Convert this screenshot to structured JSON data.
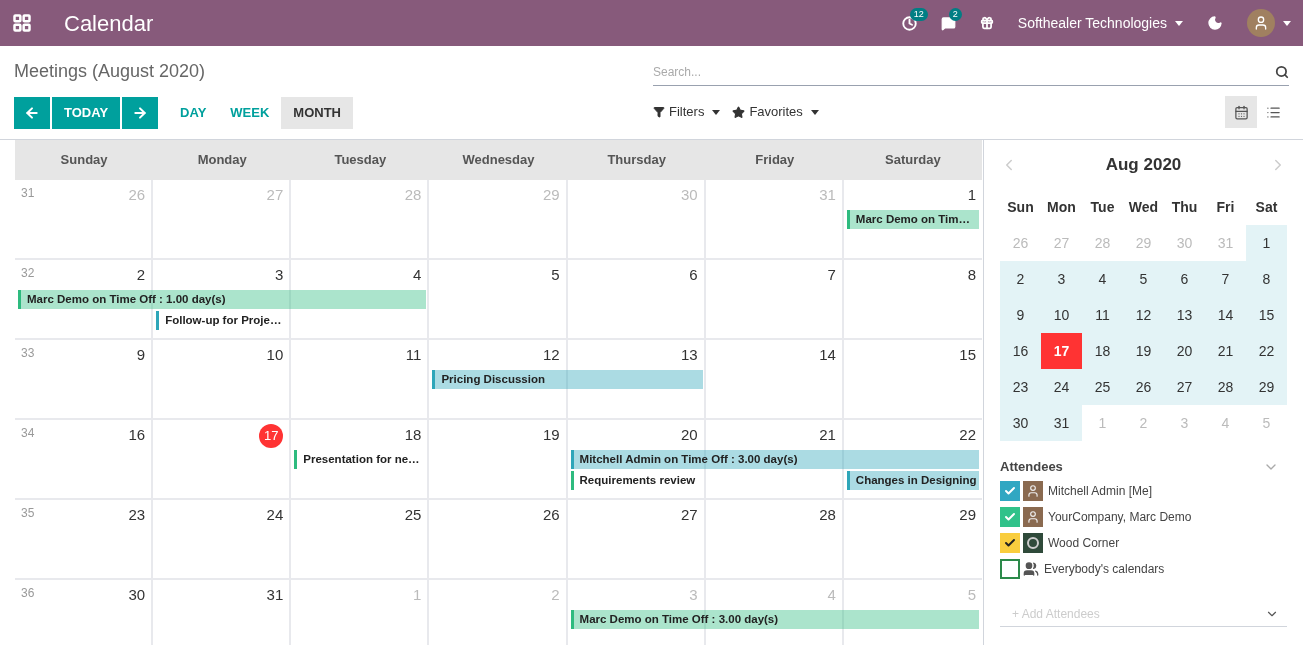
{
  "topbar": {
    "app_title": "Calendar",
    "activity_count": "12",
    "message_count": "2",
    "company": "Softhealer Technologies"
  },
  "control_panel": {
    "title": "Meetings (August 2020)",
    "search": {
      "placeholder": "Search..."
    },
    "today_label": "TODAY",
    "scales": [
      {
        "label": "DAY",
        "selected": false
      },
      {
        "label": "WEEK",
        "selected": false
      },
      {
        "label": "MONTH",
        "selected": true
      }
    ],
    "filters_label": "Filters",
    "favorites_label": "Favorites",
    "views": [
      {
        "kind": "calendar",
        "selected": true
      },
      {
        "kind": "list",
        "selected": false
      }
    ]
  },
  "calendar": {
    "weekdays": [
      "Sunday",
      "Monday",
      "Tuesday",
      "Wednesday",
      "Thursday",
      "Friday",
      "Saturday"
    ],
    "weeks": [
      {
        "number": "31",
        "days": [
          {
            "day": "26",
            "muted": true,
            "today": false
          },
          {
            "day": "27",
            "muted": true,
            "today": false
          },
          {
            "day": "28",
            "muted": true,
            "today": false
          },
          {
            "day": "29",
            "muted": true,
            "today": false
          },
          {
            "day": "30",
            "muted": true,
            "today": false
          },
          {
            "day": "31",
            "muted": true,
            "today": false
          },
          {
            "day": "1",
            "muted": false,
            "today": false,
            "events": [
              {
                "kind": "event",
                "title": "Marc Demo on Tim…",
                "color": "#2ebb7f",
                "filled": true
              }
            ]
          }
        ]
      },
      {
        "number": "32",
        "days": [
          {
            "day": "2",
            "muted": false,
            "today": false,
            "events": [
              {
                "kind": "event",
                "title": "Marc Demo on Time Off : 1.00 day(s)",
                "color": "#2ebb7f",
                "filled": true
              }
            ]
          },
          {
            "day": "3",
            "muted": false,
            "today": false,
            "events": [
              {
                "kind": "continued"
              },
              {
                "kind": "event",
                "title": "Follow-up for Proje…",
                "color": "#2ea6b9",
                "filled": false
              }
            ]
          },
          {
            "day": "4",
            "muted": false,
            "today": false,
            "events": [
              {
                "kind": "continued"
              }
            ]
          },
          {
            "day": "5",
            "muted": false,
            "today": false
          },
          {
            "day": "6",
            "muted": false,
            "today": false
          },
          {
            "day": "7",
            "muted": false,
            "today": false
          },
          {
            "day": "8",
            "muted": false,
            "today": false
          }
        ]
      },
      {
        "number": "33",
        "days": [
          {
            "day": "9",
            "muted": false,
            "today": false
          },
          {
            "day": "10",
            "muted": false,
            "today": false
          },
          {
            "day": "11",
            "muted": false,
            "today": false
          },
          {
            "day": "12",
            "muted": false,
            "today": false,
            "events": [
              {
                "kind": "event",
                "title": "Pricing Discussion",
                "color": "#2ea6b9",
                "filled": true
              }
            ]
          },
          {
            "day": "13",
            "muted": false,
            "today": false,
            "events": [
              {
                "kind": "continued"
              }
            ]
          },
          {
            "day": "14",
            "muted": false,
            "today": false
          },
          {
            "day": "15",
            "muted": false,
            "today": false
          }
        ]
      },
      {
        "number": "34",
        "days": [
          {
            "day": "16",
            "muted": false,
            "today": false
          },
          {
            "day": "17",
            "muted": false,
            "today": true
          },
          {
            "day": "18",
            "muted": false,
            "today": false,
            "events": [
              {
                "kind": "event",
                "title": "Presentation for ne…",
                "color": "#2ebb7f",
                "filled": false
              }
            ]
          },
          {
            "day": "19",
            "muted": false,
            "today": false
          },
          {
            "day": "20",
            "muted": false,
            "today": false,
            "events": [
              {
                "kind": "event",
                "title": "Mitchell Admin on Time Off : 3.00 day(s)",
                "color": "#2ea6b9",
                "filled": true
              },
              {
                "kind": "event",
                "title": "Requirements review",
                "color": "#2ebb7f",
                "filled": false
              }
            ]
          },
          {
            "day": "21",
            "muted": false,
            "today": false,
            "events": [
              {
                "kind": "continued"
              }
            ]
          },
          {
            "day": "22",
            "muted": false,
            "today": false,
            "events": [
              {
                "kind": "continued"
              },
              {
                "kind": "event",
                "title": "Changes in Designing",
                "color": "#2ea6b9",
                "filled": true
              }
            ]
          }
        ]
      },
      {
        "number": "35",
        "days": [
          {
            "day": "23",
            "muted": false,
            "today": false
          },
          {
            "day": "24",
            "muted": false,
            "today": false
          },
          {
            "day": "25",
            "muted": false,
            "today": false
          },
          {
            "day": "26",
            "muted": false,
            "today": false
          },
          {
            "day": "27",
            "muted": false,
            "today": false
          },
          {
            "day": "28",
            "muted": false,
            "today": false
          },
          {
            "day": "29",
            "muted": false,
            "today": false
          }
        ]
      },
      {
        "number": "36",
        "days": [
          {
            "day": "30",
            "muted": false,
            "today": false
          },
          {
            "day": "31",
            "muted": false,
            "today": false
          },
          {
            "day": "1",
            "muted": true,
            "today": false
          },
          {
            "day": "2",
            "muted": true,
            "today": false
          },
          {
            "day": "3",
            "muted": true,
            "today": false,
            "events": [
              {
                "kind": "event",
                "title": "Marc Demo on Time Off : 3.00 day(s)",
                "color": "#2ebb7f",
                "filled": true
              }
            ]
          },
          {
            "day": "4",
            "muted": true,
            "today": false,
            "events": [
              {
                "kind": "continued"
              }
            ]
          },
          {
            "day": "5",
            "muted": true,
            "today": false,
            "events": [
              {
                "kind": "continued"
              }
            ]
          }
        ]
      }
    ]
  },
  "mini_calendar": {
    "month": "Aug 2020",
    "weekdays": [
      "Sun",
      "Mon",
      "Tue",
      "Wed",
      "Thu",
      "Fri",
      "Sat"
    ],
    "weeks": [
      [
        {
          "day": "26",
          "muted": true,
          "today": false
        },
        {
          "day": "27",
          "muted": true,
          "today": false
        },
        {
          "day": "28",
          "muted": true,
          "today": false
        },
        {
          "day": "29",
          "muted": true,
          "today": false
        },
        {
          "day": "30",
          "muted": true,
          "today": false
        },
        {
          "day": "31",
          "muted": true,
          "today": false
        },
        {
          "day": "1",
          "muted": false,
          "today": false
        }
      ],
      [
        {
          "day": "2",
          "muted": false,
          "today": false
        },
        {
          "day": "3",
          "muted": false,
          "today": false
        },
        {
          "day": "4",
          "muted": false,
          "today": false
        },
        {
          "day": "5",
          "muted": false,
          "today": false
        },
        {
          "day": "6",
          "muted": false,
          "today": false
        },
        {
          "day": "7",
          "muted": false,
          "today": false
        },
        {
          "day": "8",
          "muted": false,
          "today": false
        }
      ],
      [
        {
          "day": "9",
          "muted": false,
          "today": false
        },
        {
          "day": "10",
          "muted": false,
          "today": false
        },
        {
          "day": "11",
          "muted": false,
          "today": false
        },
        {
          "day": "12",
          "muted": false,
          "today": false
        },
        {
          "day": "13",
          "muted": false,
          "today": false
        },
        {
          "day": "14",
          "muted": false,
          "today": false
        },
        {
          "day": "15",
          "muted": false,
          "today": false
        }
      ],
      [
        {
          "day": "16",
          "muted": false,
          "today": false
        },
        {
          "day": "17",
          "muted": false,
          "today": true
        },
        {
          "day": "18",
          "muted": false,
          "today": false
        },
        {
          "day": "19",
          "muted": false,
          "today": false
        },
        {
          "day": "20",
          "muted": false,
          "today": false
        },
        {
          "day": "21",
          "muted": false,
          "today": false
        },
        {
          "day": "22",
          "muted": false,
          "today": false
        }
      ],
      [
        {
          "day": "23",
          "muted": false,
          "today": false
        },
        {
          "day": "24",
          "muted": false,
          "today": false
        },
        {
          "day": "25",
          "muted": false,
          "today": false
        },
        {
          "day": "26",
          "muted": false,
          "today": false
        },
        {
          "day": "27",
          "muted": false,
          "today": false
        },
        {
          "day": "28",
          "muted": false,
          "today": false
        },
        {
          "day": "29",
          "muted": false,
          "today": false
        }
      ],
      [
        {
          "day": "30",
          "muted": false,
          "today": false
        },
        {
          "day": "31",
          "muted": false,
          "today": false
        },
        {
          "day": "1",
          "muted": true,
          "today": false
        },
        {
          "day": "2",
          "muted": true,
          "today": false
        },
        {
          "day": "3",
          "muted": true,
          "today": false
        },
        {
          "day": "4",
          "muted": true,
          "today": false
        },
        {
          "day": "5",
          "muted": true,
          "today": false
        }
      ]
    ]
  },
  "attendees": {
    "title": "Attendees",
    "items": [
      {
        "name": "Mitchell Admin [Me]",
        "checked": true,
        "color": "#30a7c2",
        "kind": "photo"
      },
      {
        "name": "YourCompany, Marc Demo",
        "checked": true,
        "color": "#30c28a",
        "kind": "photo"
      },
      {
        "name": "Wood Corner",
        "checked": true,
        "color": "#f9cd3e",
        "kind": "logo"
      },
      {
        "name": "Everybody's calendars",
        "checked": false,
        "color": "#2c8a4a",
        "kind": "group"
      }
    ],
    "add_placeholder": "+ Add Attendees"
  }
}
